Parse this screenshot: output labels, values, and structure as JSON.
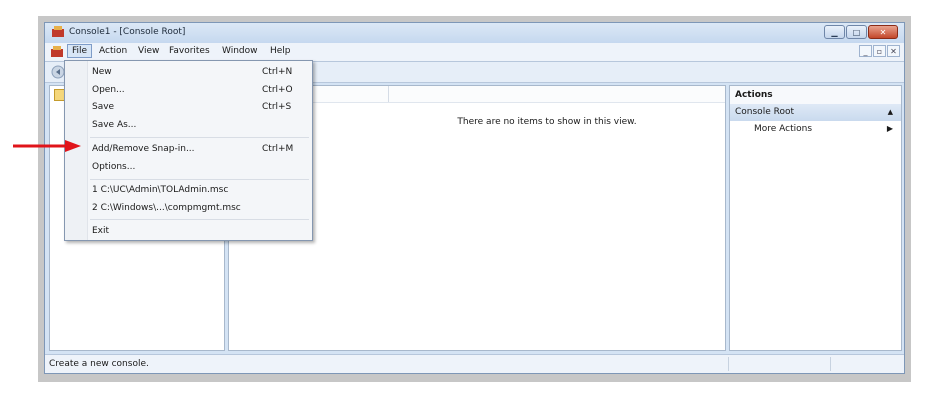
{
  "window": {
    "title": "Console1 - [Console Root]"
  },
  "menubar": {
    "file": "File",
    "action": "Action",
    "view": "View",
    "favorites": "Favorites",
    "window": "Window",
    "help": "Help"
  },
  "file_menu": {
    "new": "New",
    "new_shortcut": "Ctrl+N",
    "open": "Open...",
    "open_shortcut": "Ctrl+O",
    "save": "Save",
    "save_shortcut": "Ctrl+S",
    "save_as": "Save As...",
    "add_remove": "Add/Remove Snap-in...",
    "add_remove_shortcut": "Ctrl+M",
    "options": "Options...",
    "recent1": "1 C:\\UC\\Admin\\TOLAdmin.msc",
    "recent2": "2 C:\\Windows\\...\\compmgmt.msc",
    "exit": "Exit"
  },
  "center": {
    "empty_message": "There are no items to show in this view."
  },
  "actions": {
    "title": "Actions",
    "section": "Console Root",
    "more": "More Actions"
  },
  "status": {
    "text": "Create a new console."
  },
  "colors": {
    "arrow": "#e0141a",
    "title_bar": "#c5d8ef",
    "close_button": "#c3472a"
  }
}
